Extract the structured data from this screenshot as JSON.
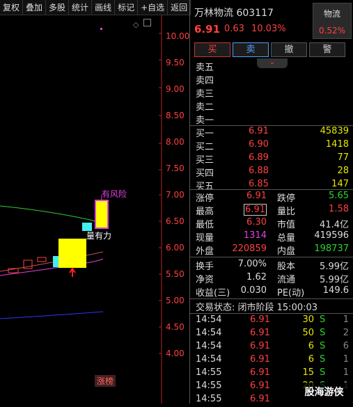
{
  "toolbar": [
    "复权",
    "叠加",
    "多股",
    "统计",
    "画线",
    "标记",
    "+自选",
    "返回"
  ],
  "chart": {
    "y_ticks": [
      "10.00",
      "9.50",
      "9.00",
      "8.50",
      "8.00",
      "7.50",
      "7.00",
      "6.50",
      "6.00",
      "5.50",
      "5.00",
      "4.50",
      "4.00"
    ],
    "annotation_risk": "有风险",
    "annotation_vol": "量有力",
    "badge": "涨榜"
  },
  "quote": {
    "name": "万林物流 603117",
    "price": "6.91",
    "change": "0.63",
    "change_pct": "10.03%",
    "watch_label": "物流",
    "watch_value": "0.52%"
  },
  "actions": [
    "买",
    "卖",
    "撤",
    "警"
  ],
  "sell_levels": [
    "卖五",
    "卖四",
    "卖三",
    "卖二",
    "卖一"
  ],
  "buy_levels": [
    {
      "label": "买一",
      "price": "6.91",
      "vol": "45839"
    },
    {
      "label": "买二",
      "price": "6.90",
      "vol": "1418"
    },
    {
      "label": "买三",
      "price": "6.89",
      "vol": "77"
    },
    {
      "label": "买四",
      "price": "6.88",
      "vol": "28"
    },
    {
      "label": "买五",
      "price": "6.85",
      "vol": "147"
    }
  ],
  "stats": [
    {
      "k": "涨停",
      "v": "6.91",
      "k2": "跌停",
      "v2": "5.65"
    },
    {
      "k": "最高",
      "v": "6.91",
      "k2": "量比",
      "v2": "1.58"
    },
    {
      "k": "最低",
      "v": "6.30",
      "k2": "市值",
      "v2": "41.4亿"
    },
    {
      "k": "现量",
      "v": "1314",
      "k2": "总量",
      "v2": "419596"
    },
    {
      "k": "外盘",
      "v": "220859",
      "k2": "内盘",
      "v2": "198737"
    }
  ],
  "stats2": [
    {
      "k": "换手",
      "v": "7.00%",
      "k2": "股本",
      "v2": "5.99亿"
    },
    {
      "k": "净资",
      "v": "1.62",
      "k2": "流通",
      "v2": "5.99亿"
    },
    {
      "k": "收益(三)",
      "v": "0.030",
      "k2": "PE(动)",
      "v2": "149.6"
    }
  ],
  "trade_status": "交易状态: 闭市阶段 15:00:03",
  "ticks": [
    {
      "t": "14:54",
      "p": "6.91",
      "v": "30",
      "d": "S",
      "n": "1"
    },
    {
      "t": "14:54",
      "p": "6.91",
      "v": "50",
      "d": "S",
      "n": "2"
    },
    {
      "t": "14:54",
      "p": "6.91",
      "v": "6",
      "d": "S",
      "n": "6"
    },
    {
      "t": "14:54",
      "p": "6.91",
      "v": "6",
      "d": "S",
      "n": "1"
    },
    {
      "t": "14:55",
      "p": "6.91",
      "v": "15",
      "d": "S",
      "n": "1"
    },
    {
      "t": "14:55",
      "p": "6.91",
      "v": "20",
      "d": "S",
      "n": "1"
    },
    {
      "t": "14:55",
      "p": "6.91",
      "v": "",
      "d": "",
      "n": ""
    }
  ],
  "watermark": "股海游侠"
}
